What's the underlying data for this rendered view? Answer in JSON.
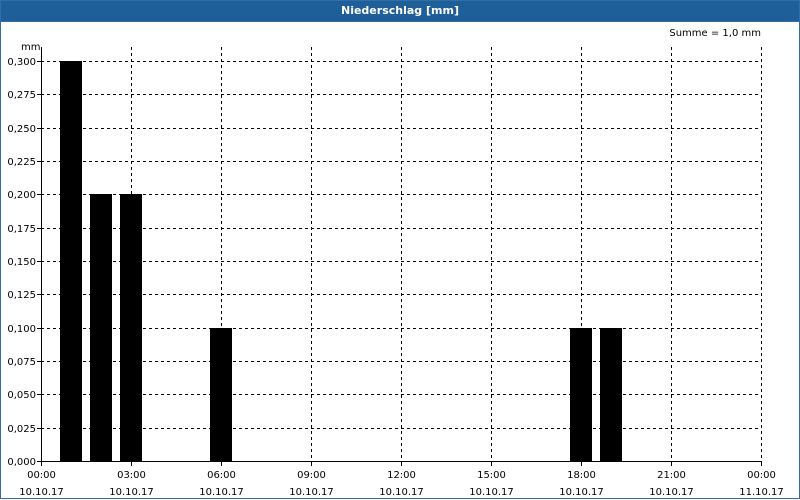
{
  "window": {
    "title": "Niederschlag [mm]"
  },
  "chart_data": {
    "type": "bar",
    "title": "Niederschlag [mm]",
    "ylabel": "mm",
    "annotation": "Summe = 1,0 mm",
    "ylim": [
      0,
      0.3
    ],
    "yticks": [
      "0,000",
      "0,025",
      "0,050",
      "0,075",
      "0,100",
      "0,125",
      "0,150",
      "0,175",
      "0,200",
      "0,225",
      "0,250",
      "0,275",
      "0,300"
    ],
    "xlim_hours": [
      0,
      24
    ],
    "xticks": [
      {
        "time": "00:00",
        "date": "10.10.17"
      },
      {
        "time": "03:00",
        "date": "10.10.17"
      },
      {
        "time": "06:00",
        "date": "10.10.17"
      },
      {
        "time": "09:00",
        "date": "10.10.17"
      },
      {
        "time": "12:00",
        "date": "10.10.17"
      },
      {
        "time": "15:00",
        "date": "10.10.17"
      },
      {
        "time": "18:00",
        "date": "10.10.17"
      },
      {
        "time": "21:00",
        "date": "10.10.17"
      },
      {
        "time": "00:00",
        "date": "11.10.17"
      }
    ],
    "bars": [
      {
        "hour": 1,
        "value": 0.3
      },
      {
        "hour": 2,
        "value": 0.2
      },
      {
        "hour": 3,
        "value": 0.2
      },
      {
        "hour": 6,
        "value": 0.1
      },
      {
        "hour": 18,
        "value": 0.1
      },
      {
        "hour": 19,
        "value": 0.1
      }
    ],
    "bar_color": "#000000",
    "grid": true
  }
}
